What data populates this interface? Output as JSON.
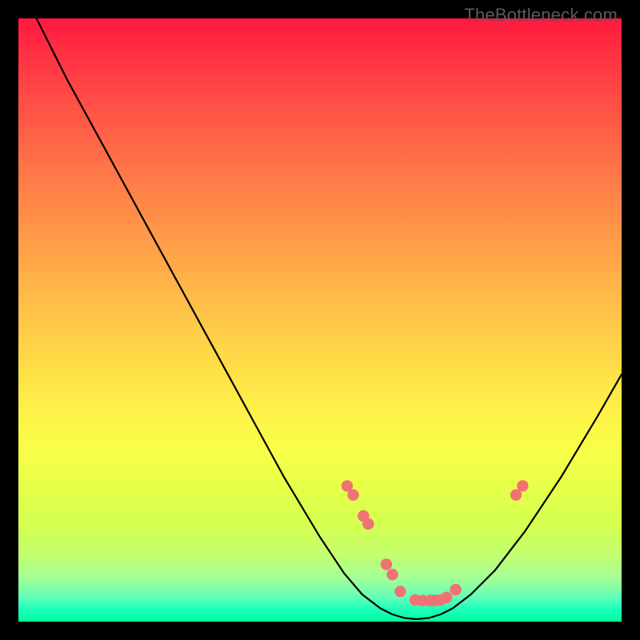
{
  "watermark": "TheBottleneck.com",
  "chart_data": {
    "type": "line",
    "title": "",
    "xlabel": "",
    "ylabel": "",
    "xlim": [
      0,
      100
    ],
    "ylim": [
      0,
      100
    ],
    "series": [
      {
        "name": "bottleneck-curve",
        "x": [
          3,
          8,
          14,
          20,
          26,
          32,
          38,
          44,
          50,
          54,
          57,
          60,
          62,
          64,
          66,
          68,
          70,
          72,
          75,
          79,
          84,
          90,
          96,
          100
        ],
        "y": [
          100,
          90,
          79,
          68,
          57,
          46,
          35,
          24,
          14,
          8,
          4.5,
          2.2,
          1.2,
          0.6,
          0.4,
          0.6,
          1.2,
          2.2,
          4.5,
          8.5,
          15,
          24,
          34,
          41
        ]
      }
    ],
    "points": {
      "name": "highlight-dots",
      "x": [
        54.5,
        55.5,
        57.2,
        58.0,
        61.0,
        62.0,
        63.3,
        65.8,
        67.0,
        68.3,
        69.0,
        70.0,
        71.0,
        72.5,
        82.5,
        83.6
      ],
      "y": [
        22.5,
        21.0,
        17.5,
        16.2,
        9.5,
        7.8,
        5.0,
        3.6,
        3.5,
        3.5,
        3.5,
        3.6,
        4.0,
        5.3,
        21.0,
        22.5
      ]
    }
  }
}
